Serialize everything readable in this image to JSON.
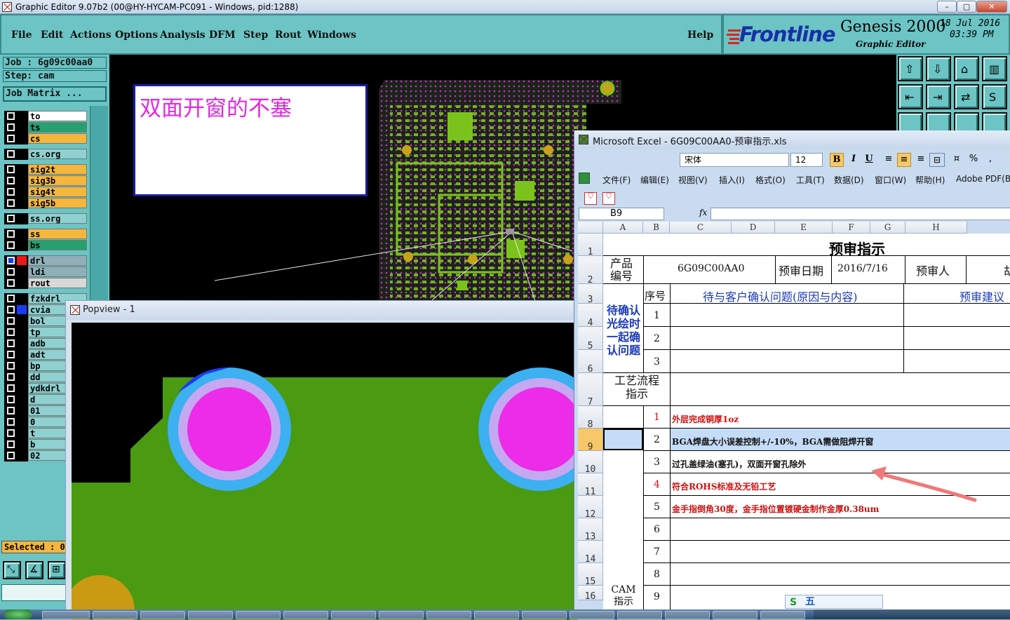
{
  "titlebar": {
    "title": "Graphic Editor 9.07b2 (00@HY-HYCAM-PC091 - Windows, pid:1288)",
    "min": "–",
    "max": "▢",
    "close": "✕"
  },
  "menu": {
    "items": [
      "File",
      "Edit",
      "Actions",
      "Options",
      "Analysis",
      "DFM",
      "Step",
      "Rout",
      "Windows"
    ],
    "help": "Help"
  },
  "brand": {
    "logo": "Frontline",
    "product": "Genesis 2000",
    "sub": "Graphic Editor",
    "date": "18 Jul 2016",
    "time": "03:39 PM"
  },
  "job": {
    "job": "Job : 6g09c00aa0",
    "step": "Step: cam",
    "matrix": "Job Matrix ..."
  },
  "layers": [
    {
      "name": "to",
      "color": "#ffffff"
    },
    {
      "name": "ts",
      "color": "#27a06f"
    },
    {
      "name": "cs",
      "color": "#f4b73b"
    },
    {
      "name": "cs.org",
      "color": "#8fd0d0"
    },
    {
      "name": "sig2t",
      "color": "#f4b73b"
    },
    {
      "name": "sig3b",
      "color": "#f4b73b"
    },
    {
      "name": "sig4t",
      "color": "#f4b73b"
    },
    {
      "name": "sig5b",
      "color": "#f4b73b"
    },
    {
      "name": "ss.org",
      "color": "#8fd0d0"
    },
    {
      "name": "ss",
      "color": "#f4b73b"
    },
    {
      "name": "bs",
      "color": "#27a06f"
    },
    {
      "name": "drl",
      "color": "#8fb0b8"
    },
    {
      "name": "ldi",
      "color": "#8fb0b8"
    },
    {
      "name": "rout",
      "color": "#d8d8d8"
    },
    {
      "name": "fzkdrl",
      "color": "#8fd0d0"
    },
    {
      "name": "cvia",
      "color": "#8fd0d0"
    },
    {
      "name": "bol",
      "color": "#8fd0d0"
    },
    {
      "name": "tp",
      "color": "#8fd0d0"
    },
    {
      "name": "adb",
      "color": "#8fd0d0"
    },
    {
      "name": "adt",
      "color": "#8fd0d0"
    },
    {
      "name": "bp",
      "color": "#8fd0d0"
    },
    {
      "name": "dd",
      "color": "#8fd0d0"
    },
    {
      "name": "ydkdrl",
      "color": "#8fd0d0"
    },
    {
      "name": "d",
      "color": "#8fd0d0"
    },
    {
      "name": "01",
      "color": "#8fd0d0"
    },
    {
      "name": "0",
      "color": "#8fd0d0"
    },
    {
      "name": "t",
      "color": "#8fd0d0"
    },
    {
      "name": "b",
      "color": "#8fd0d0"
    },
    {
      "name": "02",
      "color": "#8fd0d0"
    }
  ],
  "selected": "Selected : 0",
  "note": {
    "text": "双面开窗的不塞"
  },
  "popview": {
    "title": "Popview - 1"
  },
  "excel": {
    "title": "Microsoft Excel - 6G09C00AA0-预审指示.xls",
    "font": "宋体",
    "size": "12",
    "menus": [
      "文件(F)",
      "编辑(E)",
      "视图(V)",
      "插入(I)",
      "格式(O)",
      "工具(T)",
      "数据(D)",
      "窗口(W)",
      "帮助(H)",
      "Adobe PDF(B)"
    ],
    "namebox": "B9",
    "fx": "fx",
    "cols": [
      "A",
      "B",
      "C",
      "D",
      "E",
      "F",
      "G",
      "H"
    ],
    "rows": [
      "1",
      "2",
      "3",
      "4",
      "5",
      "6",
      "7",
      "8",
      "9",
      "10",
      "11",
      "12",
      "13",
      "14",
      "15",
      "16"
    ],
    "heading": "预审指示",
    "product_label": "产品编号",
    "product_no": "6G09C00AA0",
    "date_label": "预审日期",
    "date": "2016/7/16",
    "reviewer_label": "预审人",
    "reviewer_partial": "胡",
    "seq": "序号",
    "pending": "待与客户确认问题(原因与内容)",
    "suggest": "预审建议",
    "confirm": "待确认光绘时一起确认问题",
    "process": "工艺流程指示",
    "cam": "CAM指示",
    "nums": [
      "1",
      "2",
      "3",
      "1",
      "2",
      "3",
      "4",
      "5",
      "6",
      "7",
      "8",
      "9"
    ],
    "items": [
      "外层完成铜厚1oz",
      "BGA焊盘大小误差控制+/-10%，BGA需做阻焊开窗",
      "过孔盖绿油(塞孔)，双面开窗孔除外",
      "符合ROHS标准及无铅工艺",
      "金手指倒角30度，金手指位置镀硬金制作金厚0.38um"
    ]
  },
  "ime": {
    "label": "五"
  }
}
